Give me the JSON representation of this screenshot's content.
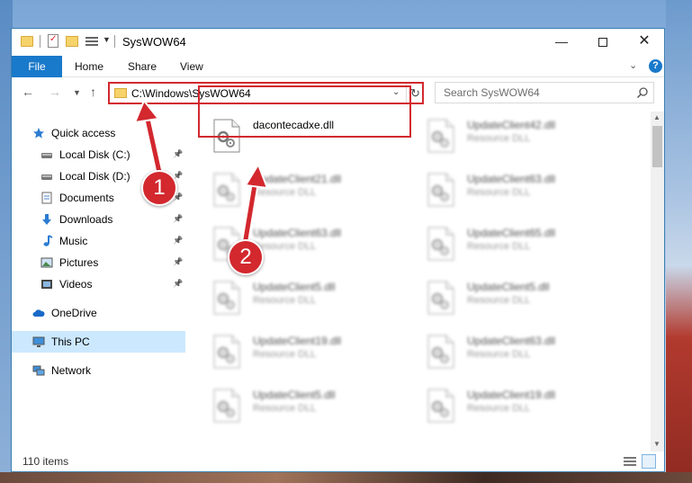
{
  "window": {
    "title": "SysWOW64",
    "controls": {
      "minimize": "—",
      "close": "✕"
    }
  },
  "ribbon": {
    "tabs": [
      "File",
      "Home",
      "Share",
      "View"
    ],
    "help": "?"
  },
  "address_bar": {
    "path": "C:\\Windows\\SysWOW64",
    "refresh_glyph": "↻"
  },
  "search": {
    "placeholder": "Search SysWOW64"
  },
  "sidebar": {
    "items": [
      {
        "label": "Quick access",
        "icon": "star-icon",
        "pinned": false
      },
      {
        "label": "Local Disk (C:)",
        "icon": "drive-icon",
        "pinned": true
      },
      {
        "label": "Local Disk (D:)",
        "icon": "drive-icon",
        "pinned": true
      },
      {
        "label": "Documents",
        "icon": "documents-icon",
        "pinned": true
      },
      {
        "label": "Downloads",
        "icon": "download-icon",
        "pinned": true
      },
      {
        "label": "Music",
        "icon": "music-icon",
        "pinned": true
      },
      {
        "label": "Pictures",
        "icon": "pictures-icon",
        "pinned": true
      },
      {
        "label": "Videos",
        "icon": "videos-icon",
        "pinned": true
      },
      {
        "label": "OneDrive",
        "icon": "cloud-icon",
        "pinned": false
      },
      {
        "label": "This PC",
        "icon": "computer-icon",
        "pinned": false,
        "active": true
      },
      {
        "label": "Network",
        "icon": "network-icon",
        "pinned": false
      }
    ]
  },
  "files": [
    {
      "name": "dacontecadxe.dll",
      "type": "",
      "blurred": false
    },
    {
      "name": "UpdateClient42.dll",
      "type": "Resource DLL",
      "blurred": true
    },
    {
      "name": "UpdateClient21.dll",
      "type": "Resource DLL",
      "blurred": true
    },
    {
      "name": "UpdateClient63.dll",
      "type": "Resource DLL",
      "blurred": true
    },
    {
      "name": "UpdateClient63.dll",
      "type": "Resource DLL",
      "blurred": true
    },
    {
      "name": "UpdateClient65.dll",
      "type": "Resource DLL",
      "blurred": true
    },
    {
      "name": "UpdateClient5.dll",
      "type": "Resource DLL",
      "blurred": true
    },
    {
      "name": "UpdateClient5.dll",
      "type": "Resource DLL",
      "blurred": true
    },
    {
      "name": "UpdateClient19.dll",
      "type": "Resource DLL",
      "blurred": true
    },
    {
      "name": "UpdateClient63.dll",
      "type": "Resource DLL",
      "blurred": true
    },
    {
      "name": "UpdateClient5.dll",
      "type": "Resource DLL",
      "blurred": true
    },
    {
      "name": "UpdateClient19.dll",
      "type": "Resource DLL",
      "blurred": true
    }
  ],
  "status": {
    "item_count": "110 items"
  },
  "annotations": {
    "step1": "1",
    "step2": "2",
    "accent": "#d2282e"
  }
}
